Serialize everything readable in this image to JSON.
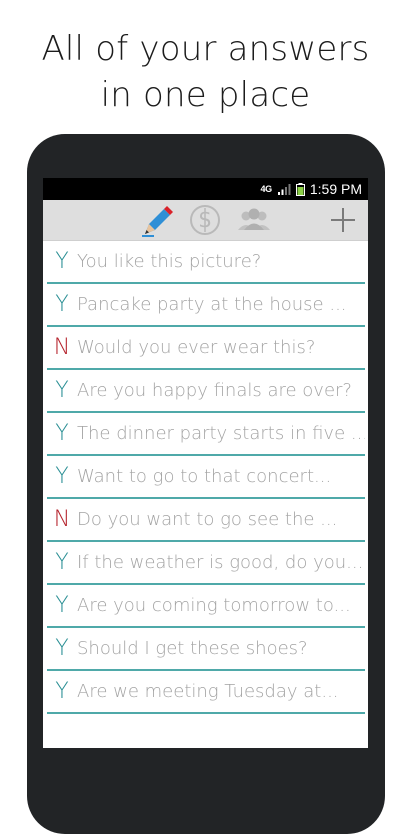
{
  "headline": {
    "line1": "All of your answers",
    "line2": "in one place"
  },
  "statusbar": {
    "network": "4G",
    "time": "1:59 PM"
  },
  "toolbar": {
    "icons": [
      "pencil-icon",
      "dollar-coin-icon",
      "group-icon",
      "plus-icon"
    ]
  },
  "questions": [
    {
      "answer": "Y",
      "text": "You like this picture?"
    },
    {
      "answer": "Y",
      "text": "Pancake party at the house ..."
    },
    {
      "answer": "N",
      "text": "Would you ever wear this?"
    },
    {
      "answer": "Y",
      "text": "Are you happy finals are over?"
    },
    {
      "answer": "Y",
      "text": "The dinner party starts in five ..."
    },
    {
      "answer": "Y",
      "text": "Want to go to that concert..."
    },
    {
      "answer": "N",
      "text": "Do you want to go see the ..."
    },
    {
      "answer": "Y",
      "text": "If the weather is good, do you..."
    },
    {
      "answer": "Y",
      "text": "Are you coming tomorrow to..."
    },
    {
      "answer": "Y",
      "text": "Should I get these shoes?"
    },
    {
      "answer": "Y",
      "text": "Are we meeting Tuesday at..."
    }
  ],
  "colors": {
    "yes": "#2a8f94",
    "no": "#b5242e",
    "divider": "#4fa9a9",
    "accent": "#2f8fd6"
  }
}
